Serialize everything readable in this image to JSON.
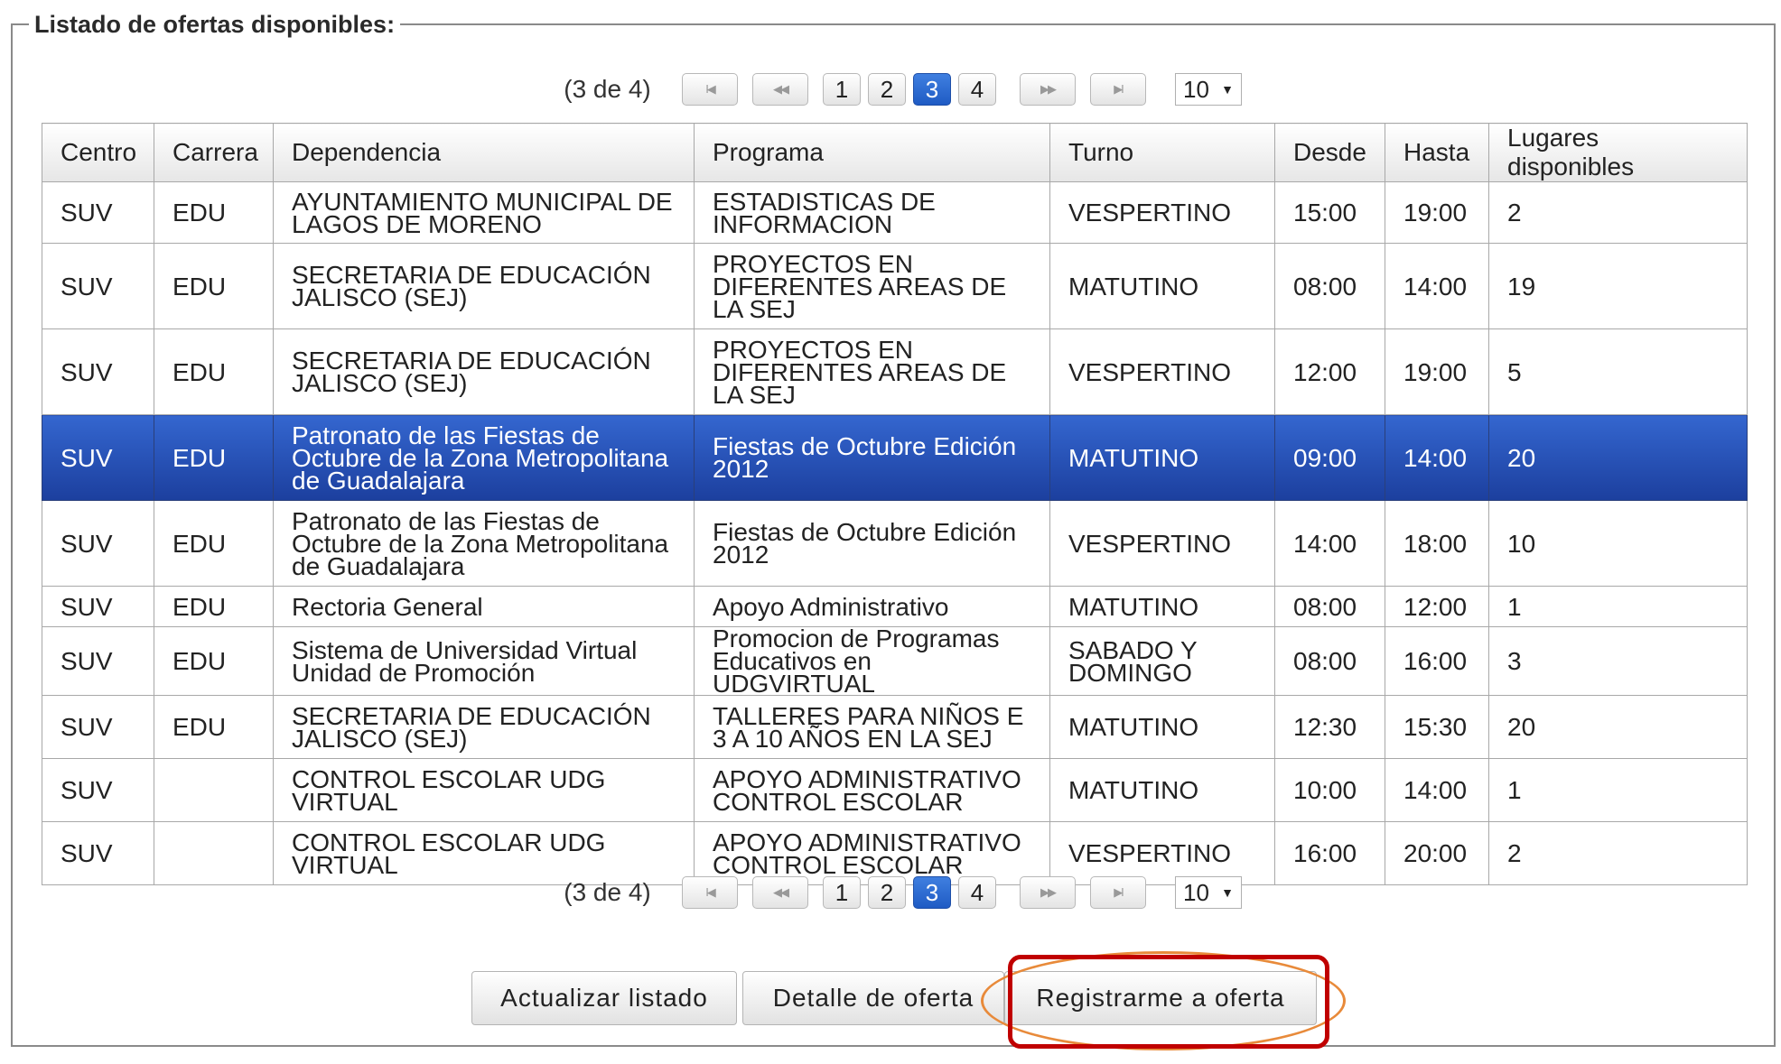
{
  "legend": "Listado de ofertas disponibles:",
  "pager": {
    "status": "(3 de 4)",
    "first_icon": "first-page-icon",
    "prev_icon": "prev-page-icon",
    "next_icon": "next-page-icon",
    "last_icon": "last-page-icon",
    "first_glyph": "I◀",
    "prev_glyph": "◀◀",
    "next_glyph": "▶▶",
    "last_glyph": "▶I",
    "pages": [
      "1",
      "2",
      "3",
      "4"
    ],
    "current_page": "3",
    "page_size": "10",
    "active_color": "#2f6fd6"
  },
  "table": {
    "columns": [
      "Centro",
      "Carrera",
      "Dependencia",
      "Programa",
      "Turno",
      "Desde",
      "Hasta",
      "Lugares disponibles"
    ],
    "rows": [
      [
        "SUV",
        "EDU",
        "AYUNTAMIENTO MUNICIPAL DE LAGOS DE MORENO",
        "ESTADISTICAS DE INFORMACION",
        "VESPERTINO",
        "15:00",
        "19:00",
        "2"
      ],
      [
        "SUV",
        "EDU",
        "SECRETARIA DE EDUCACIÓN JALISCO (SEJ)",
        "PROYECTOS EN DIFERENTES AREAS DE LA SEJ",
        "MATUTINO",
        "08:00",
        "14:00",
        "19"
      ],
      [
        "SUV",
        "EDU",
        "SECRETARIA DE EDUCACIÓN JALISCO (SEJ)",
        "PROYECTOS EN DIFERENTES AREAS DE LA SEJ",
        "VESPERTINO",
        "12:00",
        "19:00",
        "5"
      ],
      [
        "SUV",
        "EDU",
        "Patronato de las Fiestas de Octubre de la Zona Metropolitana de Guadalajara",
        "Fiestas de Octubre Edición 2012",
        "MATUTINO",
        "09:00",
        "14:00",
        "20"
      ],
      [
        "SUV",
        "EDU",
        "Patronato de las Fiestas de Octubre de la Zona Metropolitana de Guadalajara",
        "Fiestas de Octubre Edición 2012",
        "VESPERTINO",
        "14:00",
        "18:00",
        "10"
      ],
      [
        "SUV",
        "EDU",
        "Rectoria General",
        "Apoyo Administrativo",
        "MATUTINO",
        "08:00",
        "12:00",
        "1"
      ],
      [
        "SUV",
        "EDU",
        "Sistema de Universidad Virtual Unidad de Promoción",
        "Promocion de Programas Educativos en UDGVIRTUAL",
        "SABADO Y DOMINGO",
        "08:00",
        "16:00",
        "3"
      ],
      [
        "SUV",
        "EDU",
        "SECRETARIA DE EDUCACIÓN JALISCO (SEJ)",
        "TALLERES PARA NIÑOS E 3 A 10 AÑOS EN LA SEJ",
        "MATUTINO",
        "12:30",
        "15:30",
        "20"
      ],
      [
        "SUV",
        "",
        "CONTROL ESCOLAR UDG VIRTUAL",
        "APOYO ADMINISTRATIVO CONTROL ESCOLAR",
        "MATUTINO",
        "10:00",
        "14:00",
        "1"
      ],
      [
        "SUV",
        "",
        "CONTROL ESCOLAR UDG VIRTUAL",
        "APOYO ADMINISTRATIVO CONTROL ESCOLAR",
        "VESPERTINO",
        "16:00",
        "20:00",
        "2"
      ]
    ],
    "selected_row": 3,
    "selected_color": "#2a52b8"
  },
  "actions": {
    "refresh_label": "Actualizar listado",
    "detail_label": "Detalle de oferta",
    "register_label": "Registrarme a oferta"
  },
  "annotation": {
    "rect_color": "#c00000",
    "ellipse_color": "#e88a3a"
  }
}
